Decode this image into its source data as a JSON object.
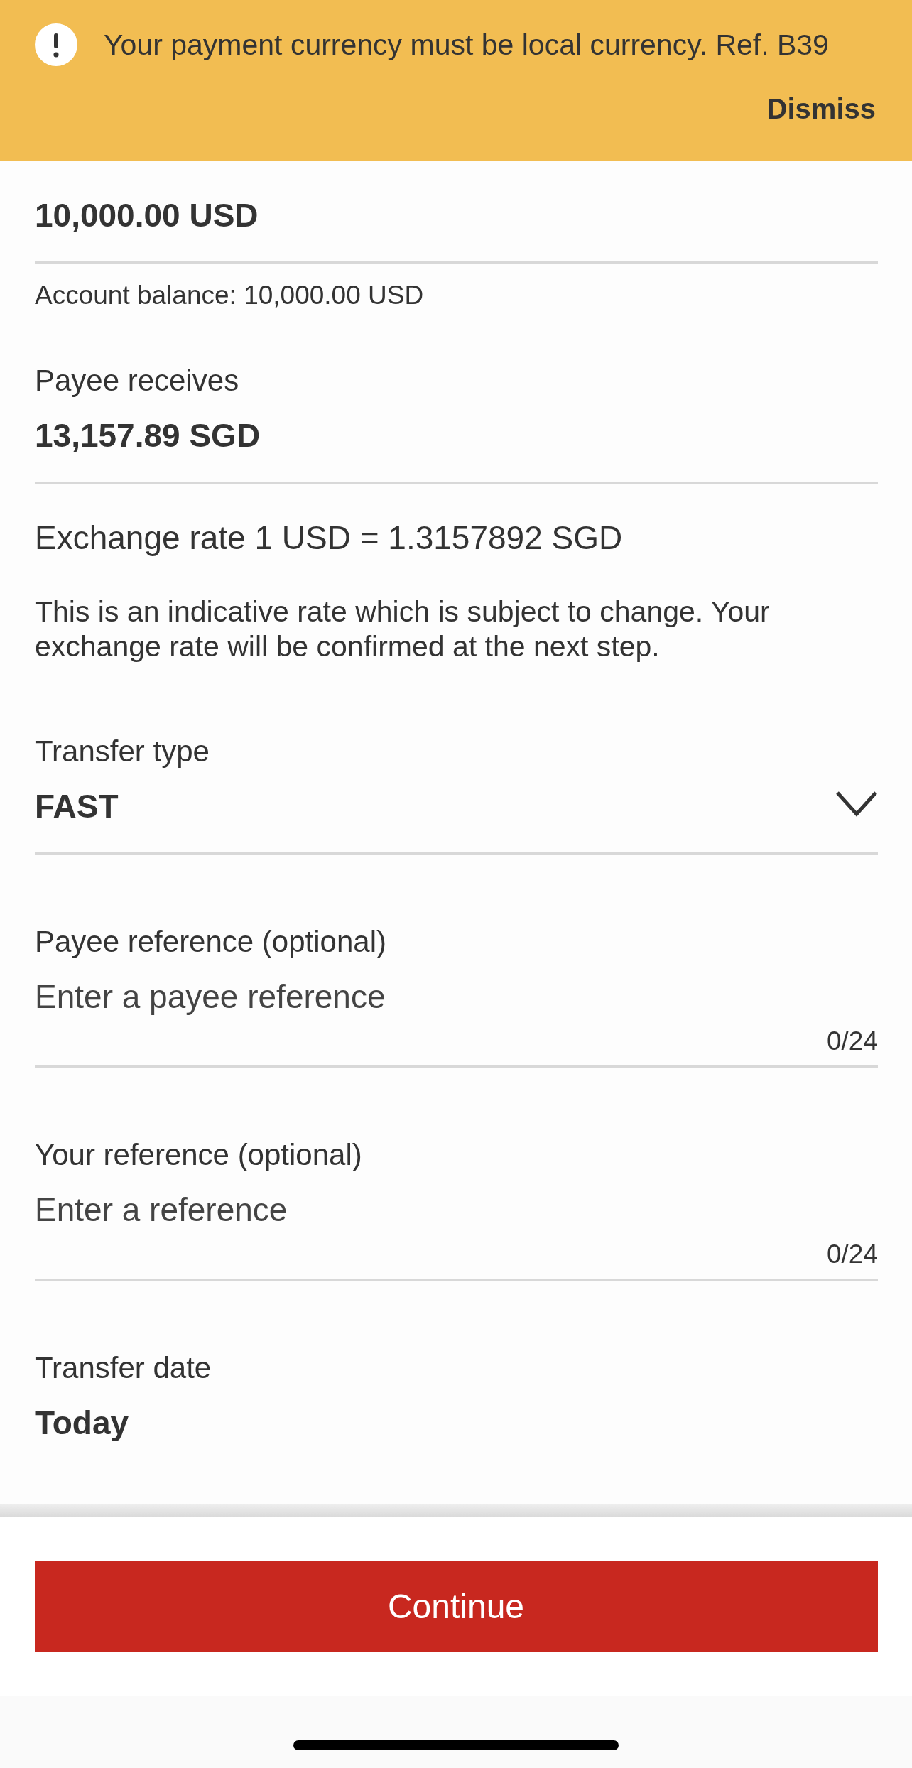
{
  "alert_banner": {
    "message": "Your payment currency must be local currency. Ref. B39",
    "action": "Dismiss"
  },
  "fields": [
    {
      "kind": "amount",
      "value": "10,000.00 USD",
      "note": "Account balance: 10,000.00 USD"
    },
    {
      "kind": "amount",
      "label": "Payee receives",
      "value": "13,157.89 SGD"
    },
    {
      "kind": "info",
      "title": "Exchange rate 1 USD = 1.3157892 SGD",
      "text": "This is an indicative rate which is subject to change. Your exchange rate will be confirmed at the next step."
    },
    {
      "kind": "select",
      "label": "Transfer type",
      "value": "FAST"
    },
    {
      "kind": "input",
      "label": "Payee reference (optional)",
      "placeholder": "Enter a payee reference",
      "counter": "0/24"
    },
    {
      "kind": "input",
      "label": "Your reference (optional)",
      "placeholder": "Enter a reference",
      "counter": "0/24"
    },
    {
      "kind": "date",
      "label": "Transfer date",
      "value": "Today"
    }
  ],
  "footer": {
    "button": "Continue"
  }
}
